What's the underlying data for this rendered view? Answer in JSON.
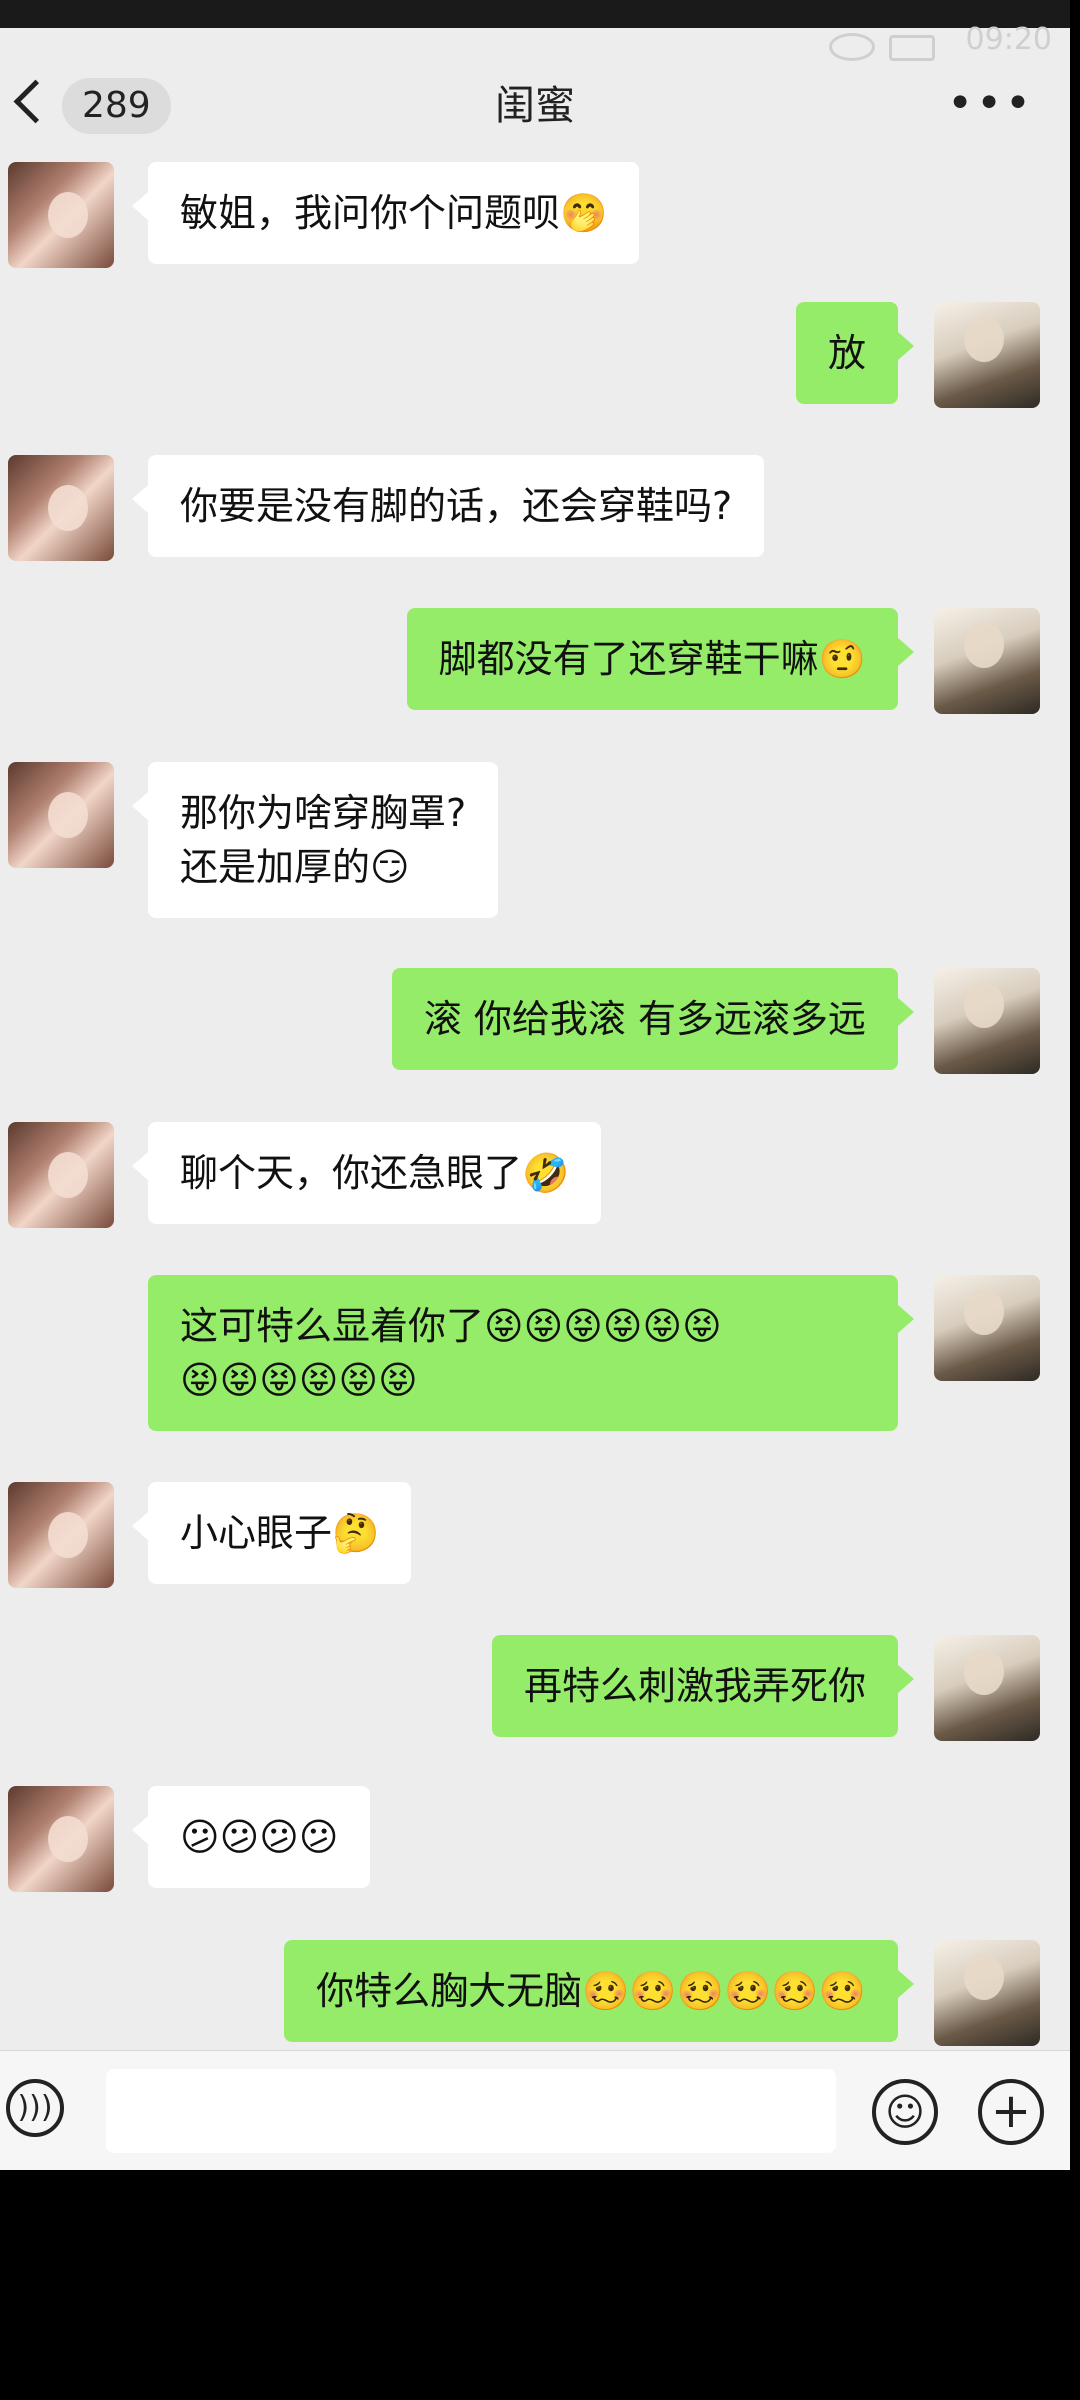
{
  "status_bar": {
    "time": "09:20"
  },
  "nav": {
    "unread_count": "289",
    "title": "闺蜜",
    "more": "•••"
  },
  "messages": [
    {
      "side": "left",
      "text": "敏姐，我问你个问题呗🤭"
    },
    {
      "side": "right",
      "text": "放"
    },
    {
      "side": "left",
      "text": "你要是没有脚的话，还会穿鞋吗?"
    },
    {
      "side": "right",
      "text": "脚都没有了还穿鞋干嘛🤨"
    },
    {
      "side": "left",
      "text": "那你为啥穿胸罩?\n还是加厚的😏"
    },
    {
      "side": "right",
      "text": "滚 你给我滚 有多远滚多远"
    },
    {
      "side": "left",
      "text": "聊个天，你还急眼了🤣"
    },
    {
      "side": "right",
      "text": "这可特么显着你了😝😝😝😝😝😝\n😝😝😝😝😝😝"
    },
    {
      "side": "left",
      "text": "小心眼子🤔"
    },
    {
      "side": "right",
      "text": "再特么刺激我弄死你"
    },
    {
      "side": "left",
      "text": "😕😕😕😕"
    },
    {
      "side": "right",
      "text": "你特么胸大无脑🥴🥴🥴🥴🥴🥴"
    }
  ],
  "input_bar": {
    "voice_icon": "voice-icon",
    "emoji_icon": "emoji-icon",
    "plus_icon": "plus-icon"
  },
  "colors": {
    "background": "#ededed",
    "left_bubble": "#ffffff",
    "right_bubble": "#95ec69"
  }
}
